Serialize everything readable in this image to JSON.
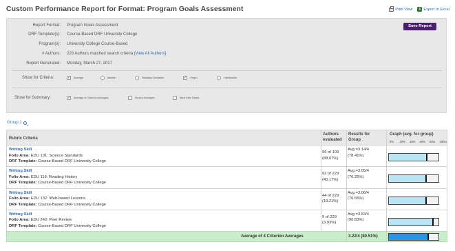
{
  "header": {
    "title": "Custom Performance Report for Format: Program Goals Assessment",
    "print_label": "Print View",
    "excel_label": "Export to Excel"
  },
  "panel": {
    "save_label": "Save Report",
    "fields": [
      {
        "label": "Report Format:",
        "value": "Program Goals Assessment"
      },
      {
        "label": "DRF Template(s):",
        "value": "Course-Based DRF University College"
      },
      {
        "label": "Program(s):",
        "value": "University College Course-Based"
      },
      {
        "label": "# Authors:",
        "value": "229 Authors matched search criteria",
        "link": "[View All Authors]"
      },
      {
        "label": "Report Generated:",
        "value": "Monday, March 27, 2017"
      }
    ],
    "criteria": {
      "label": "Show for Criteria:",
      "options": [
        {
          "label": "Average",
          "checked": true,
          "kind": "checkbox"
        },
        {
          "label": "Median",
          "checked": false,
          "kind": "radio"
        },
        {
          "label": "Standard Deviation",
          "checked": false,
          "kind": "radio"
        },
        {
          "label": "Graph",
          "checked": true,
          "kind": "checkbox"
        },
        {
          "label": "Distribution",
          "checked": false,
          "kind": "radio"
        }
      ]
    },
    "summary": {
      "label": "Show for Summary:",
      "options": [
        {
          "label": "Average of Criterion Averages",
          "checked": true
        },
        {
          "label": "Scores Averages",
          "checked": false
        },
        {
          "label": "Most Elite Twists",
          "checked": false
        }
      ]
    }
  },
  "group": {
    "label": "Group 1"
  },
  "table": {
    "headers": {
      "criteria": "Rubric Criteria",
      "authors_1": "Authors",
      "authors_2": "evaluated",
      "results_1": "Results for",
      "results_2": "Group",
      "graph": "Graph (avg. for group)"
    },
    "scale": [
      "0%",
      "20%",
      "40%",
      "60%",
      "80%",
      "100%"
    ],
    "rows": [
      {
        "skill": "Writing Skill",
        "folio_label": "Folio Area:",
        "folio": "EDU 101: Science Standards",
        "drf_label": "DRF Template:",
        "drf": "Course-Based DRF University College",
        "authors_a": "96 of 109",
        "authors_b": "(88.07%)",
        "avg": "Avg.=3.14/4",
        "pct": "(78.41%)",
        "fraction": 0.7841
      },
      {
        "skill": "Writing Skill",
        "folio_label": "Folio Area:",
        "folio": "EDU 119: Reading History",
        "drf_label": "DRF Template:",
        "drf": "Course-Based DRF University College",
        "authors_a": "92 of 229",
        "authors_b": "(40.17%)",
        "avg": "Avg.=3.05/4",
        "pct": "(76.25%)",
        "fraction": 0.7625
      },
      {
        "skill": "Writing Skill",
        "folio_label": "Folio Area:",
        "folio": "EDU 132: Web-based Lessons",
        "drf_label": "DRF Template:",
        "drf": "Course-Based DRF University College",
        "authors_a": "44 of 229",
        "authors_b": "(19.21%)",
        "avg": "Avg.=3.06/4",
        "pct": "(76.56%)",
        "fraction": 0.7656
      },
      {
        "skill": "Writing Skill",
        "folio_label": "Folio Area:",
        "folio": "EDU 240: Peer Review",
        "drf_label": "DRF Template:",
        "drf": "Course-Based DRF University College",
        "authors_a": "9 of 229",
        "authors_b": "(3.93%)",
        "avg": "Avg.=3.63/4",
        "pct": "(90.83%)",
        "fraction": 0.9083
      }
    ],
    "summary": {
      "label": "Average of 4 Criterion Averages",
      "value": "3.22/4 (80.51%)",
      "fraction": 0.8051
    }
  }
}
